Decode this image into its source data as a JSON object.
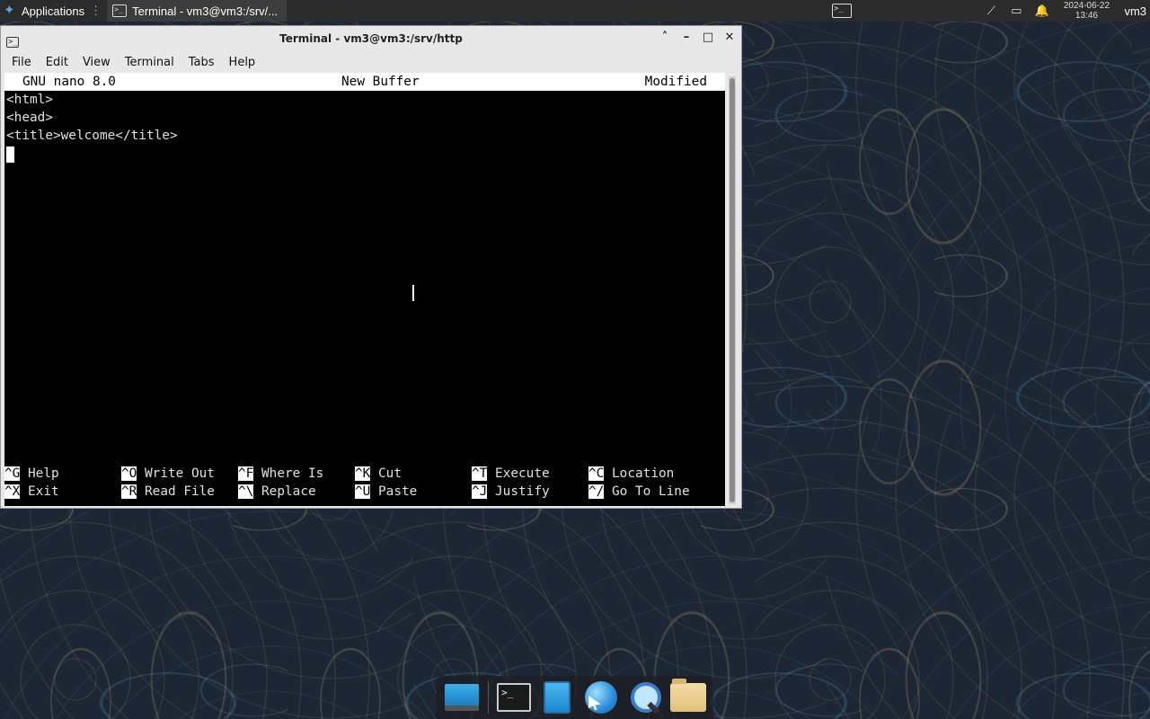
{
  "top_panel": {
    "applications_label": "Applications",
    "applications_separator": "⋮",
    "task_title": "Terminal - vm3@vm3:/srv/...",
    "clock_date": "2024-06-22",
    "clock_time": "13:46",
    "user": "vm3"
  },
  "window": {
    "title": "Terminal - vm3@vm3:/srv/http",
    "controls": {
      "shade": "˄",
      "minimize": "–",
      "maximize": "□",
      "close": "✕"
    },
    "menu": [
      "File",
      "Edit",
      "View",
      "Terminal",
      "Tabs",
      "Help"
    ]
  },
  "nano": {
    "header_left": "GNU nano 8.0",
    "header_center": "New Buffer",
    "header_right": "Modified",
    "lines": [
      "<html>",
      "<head>",
      "<title>welcome</title>"
    ],
    "shortcuts_row1": [
      {
        "key": "^G",
        "label": "Help"
      },
      {
        "key": "^O",
        "label": "Write Out"
      },
      {
        "key": "^F",
        "label": "Where Is"
      },
      {
        "key": "^K",
        "label": "Cut"
      },
      {
        "key": "^T",
        "label": "Execute"
      },
      {
        "key": "^C",
        "label": "Location"
      }
    ],
    "shortcuts_row2": [
      {
        "key": "^X",
        "label": "Exit"
      },
      {
        "key": "^R",
        "label": "Read File"
      },
      {
        "key": "^\\",
        "label": "Replace"
      },
      {
        "key": "^U",
        "label": "Paste"
      },
      {
        "key": "^J",
        "label": "Justify"
      },
      {
        "key": "^/",
        "label": "Go To Line"
      }
    ]
  },
  "terminal_icon_glyph": ">_",
  "icons": {
    "tray": [
      "network-muted-icon",
      "battery-icon",
      "bell-icon"
    ],
    "dock": [
      "desktop-icon",
      "terminal-icon",
      "phone-icon",
      "web-browser-icon",
      "search-icon",
      "folder-icon"
    ]
  }
}
